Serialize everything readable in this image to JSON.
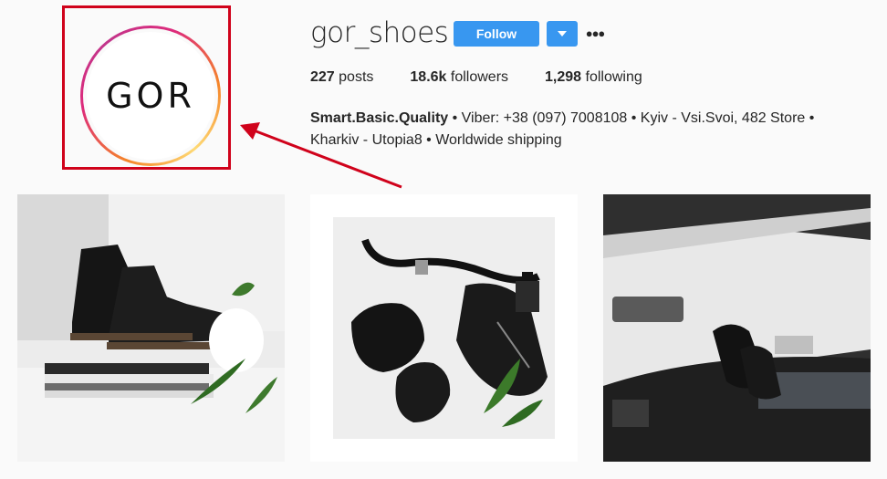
{
  "profile": {
    "avatar_text": "GOR",
    "username": "gor_shoes",
    "follow_label": "Follow",
    "more_label": "•••",
    "stats": {
      "posts_count": "227",
      "posts_label": " posts",
      "followers_count": "18.6k",
      "followers_label": " followers",
      "following_count": "1,298",
      "following_label": " following"
    },
    "bio": {
      "name": "Smart.Basic.Quality",
      "text": " • Viber: +38 (097) 7008108 • Kyiv - Vsi.Svoi, 482 Store • Kharkiv - Utopia8 • Worldwide shipping"
    }
  },
  "posts": [
    {
      "alt": "black leather boots on stack of magazines"
    },
    {
      "alt": "flat lay of boots, belt bag and perfume"
    },
    {
      "alt": "boots on car dashboard"
    }
  ],
  "colors": {
    "accent": "#3897f0",
    "annotation": "#d0021b",
    "background": "#fafafa"
  }
}
